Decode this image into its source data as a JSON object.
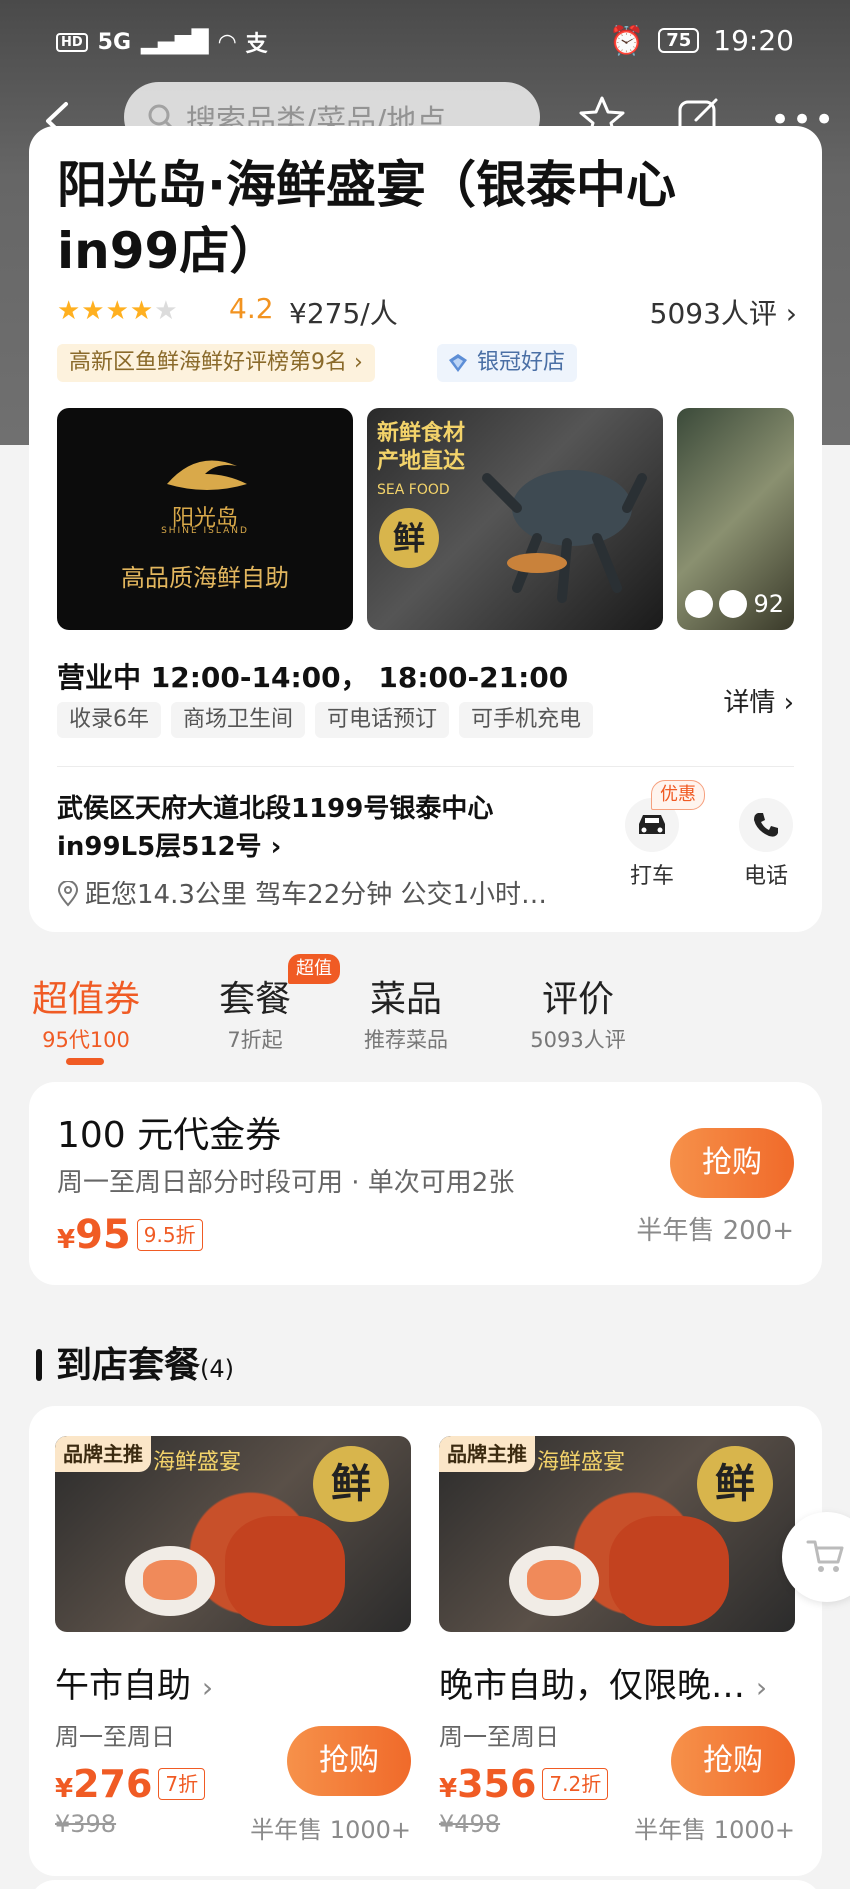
{
  "status_bar": {
    "network": "HD",
    "signal": "5G",
    "time": "19:20",
    "battery": "75"
  },
  "search": {
    "placeholder": "搜索品类/菜品/地点"
  },
  "shop": {
    "title": "阳光岛·海鲜盛宴（银泰中心in99店）",
    "rating_stars": 4,
    "score": "4.2",
    "price_per_person": "¥275/人",
    "review_count": "5093人评",
    "rank_badge": "高新区鱼鲜海鲜好评榜第9名",
    "silver_badge": "银冠好店",
    "photos": {
      "logo_name": "阳光岛",
      "logo_sub": "SHINE ISLAND",
      "slogan": "高品质海鲜自助",
      "fresh_tag": "新鲜食材\n产地直达",
      "sea_food": "SEA FOOD",
      "fresh_char": "鲜",
      "count": "92"
    },
    "hours": "营业中 12:00-14:00， 18:00-21:00",
    "tags": [
      "收录6年",
      "商场卫生间",
      "可电话预订",
      "可手机充电"
    ],
    "details_label": "详情",
    "address": "武侯区天府大道北段1199号银泰中心in99L5层512号",
    "distance": "距您14.3公里 驾车22分钟 公交1小时…",
    "actions": {
      "taxi": "打车",
      "phone": "电话",
      "promo": "优惠"
    }
  },
  "tabs": [
    {
      "label": "超值券",
      "sub": "95代100",
      "active": true
    },
    {
      "label": "套餐",
      "sub": "7折起",
      "badge": "超值"
    },
    {
      "label": "菜品",
      "sub": "推荐菜品"
    },
    {
      "label": "评价",
      "sub": "5093人评"
    }
  ],
  "voucher": {
    "title": "100 元代金券",
    "desc": "周一至周日部分时段可用 · 单次可用2张",
    "currency": "¥",
    "price": "95",
    "discount": "9.5折",
    "buy_label": "抢购",
    "sold": "半年售 200+"
  },
  "section": {
    "title": "到店套餐",
    "count": "(4)"
  },
  "sets": [
    {
      "brand_tag": "品牌主推",
      "headline": "海鲜盛宴",
      "fresh_char": "鲜",
      "name": "午市自助",
      "days": "周一至周日",
      "currency": "¥",
      "price": "276",
      "discount": "7折",
      "original": "¥398",
      "buy_label": "抢购",
      "sold": "半年售 1000+"
    },
    {
      "brand_tag": "品牌主推",
      "headline": "海鲜盛宴",
      "fresh_char": "鲜",
      "name": "晚市自助，仅限晚…",
      "days": "周一至周日",
      "currency": "¥",
      "price": "356",
      "discount": "7.2折",
      "original": "¥498",
      "buy_label": "抢购",
      "sold": "半年售 1000+"
    }
  ],
  "colors": {
    "accent": "#f05b24",
    "star": "#ffb020",
    "gold": "#d9a94a"
  }
}
